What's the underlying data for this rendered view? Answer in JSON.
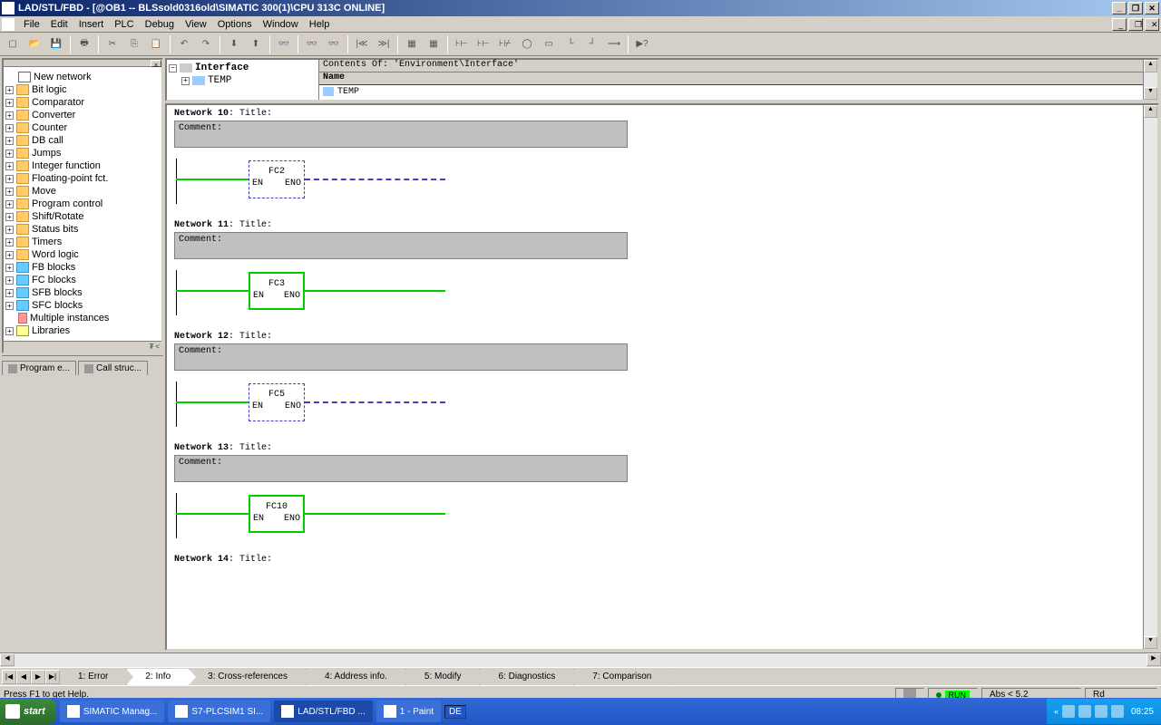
{
  "titlebar": {
    "title": "LAD/STL/FBD  - [@OB1 -- BLSsold0316old\\SIMATIC 300(1)\\CPU 313C  ONLINE]"
  },
  "menubar": {
    "items": [
      "File",
      "Edit",
      "Insert",
      "PLC",
      "Debug",
      "View",
      "Options",
      "Window",
      "Help"
    ]
  },
  "tree": {
    "new_network": "New network",
    "items": [
      "Bit logic",
      "Comparator",
      "Converter",
      "Counter",
      "DB call",
      "Jumps",
      "Integer function",
      "Floating-point fct.",
      "Move",
      "Program control",
      "Shift/Rotate",
      "Status bits",
      "Timers",
      "Word logic",
      "FB blocks",
      "FC blocks",
      "SFB blocks",
      "SFC blocks"
    ],
    "multiple": "Multiple instances",
    "libraries": "Libraries"
  },
  "left_tabs": {
    "t1": "Program e...",
    "t2": "Call struc..."
  },
  "iface": {
    "interface": "Interface",
    "temp": "TEMP",
    "contents": "Contents Of: 'Environment\\Interface'",
    "name": "Name",
    "row_temp": "TEMP"
  },
  "networks": {
    "n10": {
      "title": "Network 10",
      "suffix": ": Title:",
      "comment": "Comment:",
      "fc": "FC2",
      "en": "EN",
      "eno": "ENO",
      "active": false
    },
    "n11": {
      "title": "Network 11",
      "suffix": ": Title:",
      "comment": "Comment:",
      "fc": "FC3",
      "en": "EN",
      "eno": "ENO",
      "active": true
    },
    "n12": {
      "title": "Network 12",
      "suffix": ": Title:",
      "comment": "Comment:",
      "fc": "FC5",
      "en": "EN",
      "eno": "ENO",
      "active": false
    },
    "n13": {
      "title": "Network 13",
      "suffix": ": Title:",
      "comment": "Comment:",
      "fc": "FC10",
      "en": "EN",
      "eno": "ENO",
      "active": true
    },
    "n14": {
      "title": "Network 14",
      "suffix": ": Title:"
    }
  },
  "bottom_tabs": {
    "t1": "1: Error",
    "t2": "2: Info",
    "t3": "3: Cross-references",
    "t4": "4: Address info.",
    "t5": "5: Modify",
    "t6": "6: Diagnostics",
    "t7": "7: Comparison"
  },
  "statusbar": {
    "help": "Press F1 to get Help.",
    "run": "RUN",
    "abs": "Abs < 5.2",
    "rd": "Rd"
  },
  "taskbar": {
    "start": "start",
    "t1": "SIMATIC Manag...",
    "t2": "S7-PLCSIM1    SI...",
    "t3": "LAD/STL/FBD  ...",
    "t4": "1 - Paint",
    "lang": "DE",
    "clock": "08:25"
  }
}
